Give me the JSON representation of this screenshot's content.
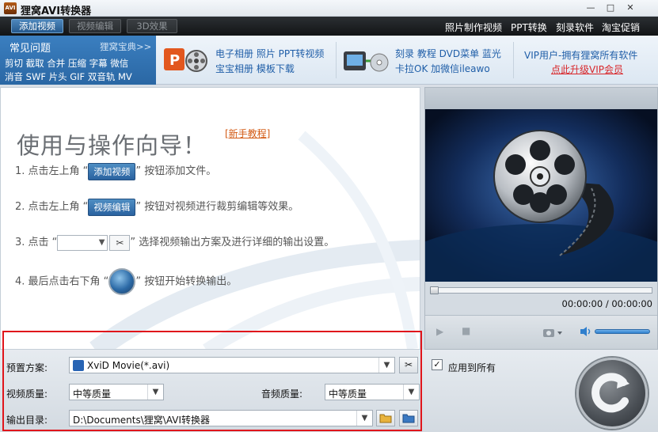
{
  "window": {
    "title": "狸窝AVI转换器",
    "logo_text": "AVI",
    "minimize": "—",
    "maximize": "□",
    "close": "✕"
  },
  "toolbar": {
    "add_video": "添加视频",
    "edit_video": "视频编辑",
    "effect_3d": "3D效果",
    "links": [
      "照片制作视频",
      "PPT转换",
      "刻录软件",
      "淘宝促销"
    ]
  },
  "banner": {
    "faq_title": "常见问题",
    "faq_more": "狸窝宝典>>",
    "faq_line1": "剪切 截取 合并 压缩 字幕 微信",
    "faq_line2": "消音 SWF 片头 GIF 双音轨 MV",
    "promo1_line1": "电子相册 照片 PPT转视频",
    "promo1_line2": "宝宝相册 模板下载",
    "promo2_line1": "刻录 教程 DVD菜单 蓝光",
    "promo2_line2": "卡拉OK 加微信ileawo",
    "vip_line1": "VIP用户-拥有狸窝所有软件",
    "vip_line2": "点此升级VIP会员"
  },
  "guide": {
    "title": "使用与操作向导！",
    "tutorial_link": "[新手教程]",
    "step1_pre": "1. 点击左上角 “",
    "step1_btn": "添加视频",
    "step1_post": "” 按钮添加文件。",
    "step2_pre": "2. 点击左上角 “",
    "step2_btn": "视频编辑",
    "step2_post": "” 按钮对视频进行裁剪编辑等效果。",
    "step3_pre": "3. 点击 “",
    "step3_post": "” 选择视频输出方案及进行详细的输出设置。",
    "step4_pre": "4. 最后点击右下角 “",
    "step4_post": "” 按钮开始转换输出。"
  },
  "player": {
    "time": "00:00:00 / 00:00:00",
    "progress": 0,
    "volume": 1
  },
  "settings": {
    "preset_label": "预置方案:",
    "preset_value": "XviD Movie(*.avi)",
    "video_quality_label": "视频质量:",
    "video_quality_value": "中等质量",
    "audio_quality_label": "音频质量:",
    "audio_quality_value": "中等质量",
    "output_label": "输出目录:",
    "output_value": "D:\\Documents\\狸窝\\AVI转换器",
    "apply_all_label": "应用到所有",
    "apply_all_checked": "✓"
  }
}
